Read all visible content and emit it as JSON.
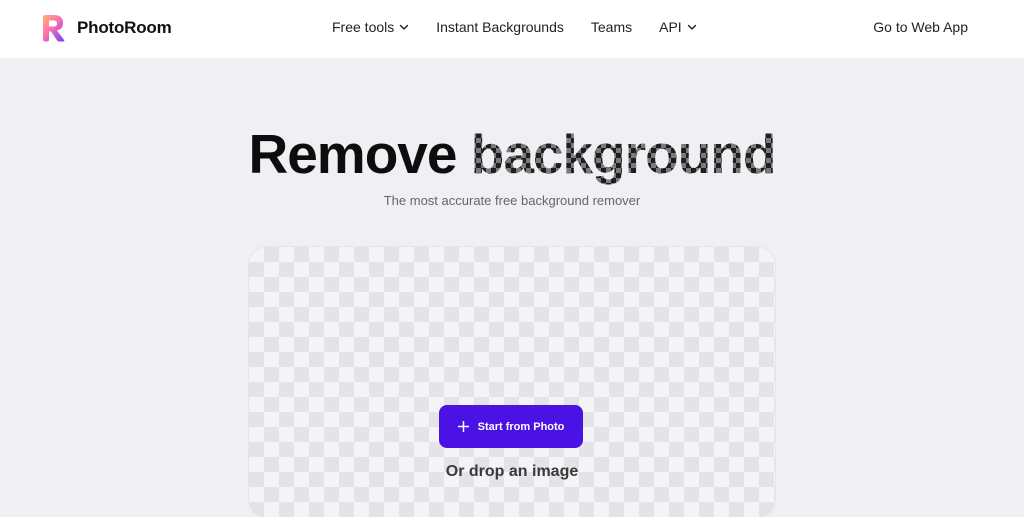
{
  "brand": {
    "name": "PhotoRoom"
  },
  "nav": {
    "items": [
      {
        "label": "Free tools",
        "has_dropdown": true
      },
      {
        "label": "Instant Backgrounds",
        "has_dropdown": false
      },
      {
        "label": "Teams",
        "has_dropdown": false
      },
      {
        "label": "API",
        "has_dropdown": true
      }
    ],
    "cta": "Go to Web App"
  },
  "hero": {
    "title_plain": "Remove",
    "title_highlight": "background",
    "subtitle": "The most accurate free background remover"
  },
  "uploader": {
    "button_label": "Start from Photo",
    "button_icon": "plus-icon",
    "drop_text": "Or drop an image"
  },
  "colors": {
    "accent": "#4b12e6",
    "page_background": "#f0f0f4",
    "nav_background": "#ffffff"
  }
}
